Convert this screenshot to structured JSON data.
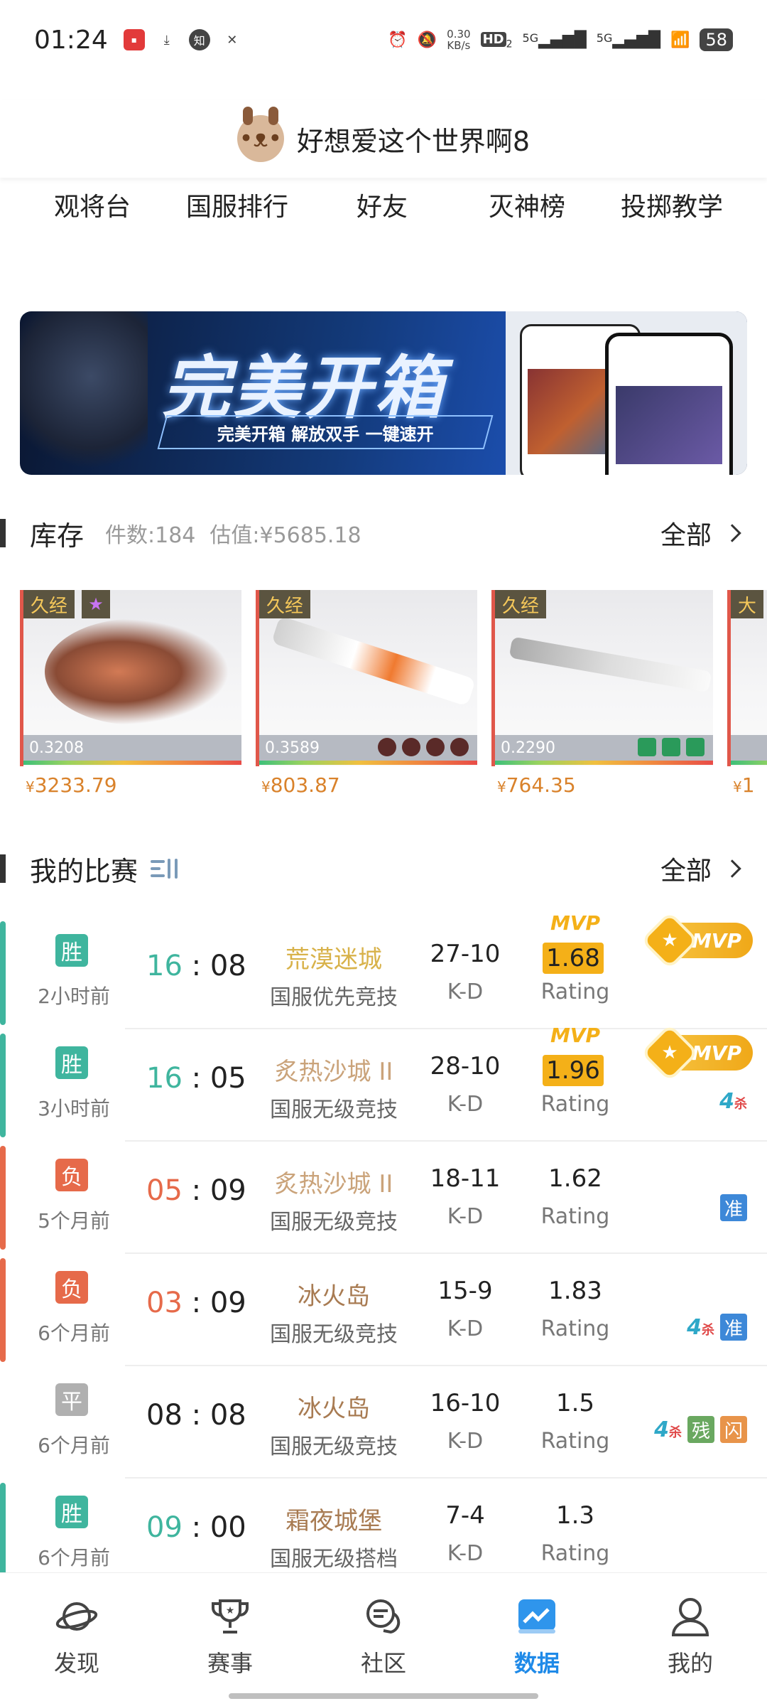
{
  "status_bar": {
    "time": "01:24",
    "net_speed_value": "0.30",
    "net_speed_unit": "KB/s",
    "hd_label": "HD",
    "hd_sub": "2",
    "sim1": "5G",
    "sim2": "5G",
    "battery": "58",
    "left_icons": [
      "app-icon",
      "download-icon",
      "zhihu-icon",
      "tools-icon"
    ],
    "zhihu_glyph": "知"
  },
  "header": {
    "title": "好想爱这个世界啊8"
  },
  "quick_nav": [
    {
      "label": "观将台"
    },
    {
      "label": "国服排行"
    },
    {
      "label": "好友"
    },
    {
      "label": "灭神榜"
    },
    {
      "label": "投掷教学"
    }
  ],
  "banner": {
    "headline": "完美开箱",
    "subline": "完美开箱 解放双手 一键速开"
  },
  "inventory": {
    "title": "库存",
    "count": "件数:184",
    "value": "估值:¥5685.18",
    "all_label": "全部",
    "items": [
      {
        "tag": "久经",
        "float": "0.3208",
        "currency": "¥",
        "price": "3233.79"
      },
      {
        "tag": "久经",
        "float": "0.3589",
        "currency": "¥",
        "price": "803.87"
      },
      {
        "tag": "久经",
        "float": "0.2290",
        "currency": "¥",
        "price": "764.35"
      },
      {
        "tag": "大",
        "currency": "¥",
        "price": "1"
      }
    ]
  },
  "matches": {
    "title": "我的比赛",
    "all_label": "全部",
    "kd_label": "K-D",
    "rating_label": "Rating",
    "mvp_label": "MVP",
    "colors": {
      "win": "#3fb59e",
      "lose": "#e66a4a",
      "draw": "#b0b0b0"
    },
    "rows": [
      {
        "result": "胜",
        "when": "2小时前",
        "s1": "16",
        "s2": "08",
        "map": "荒漠迷城",
        "mode": "国服优先竞技",
        "kd": "27-10",
        "rating": "1.68"
      },
      {
        "result": "胜",
        "when": "3小时前",
        "s1": "16",
        "s2": "05",
        "map": "炙热沙城 II",
        "mode": "国服无级竞技",
        "kd": "28-10",
        "rating": "1.96",
        "tag4": "4",
        "tag4sub": "杀"
      },
      {
        "result": "负",
        "when": "5个月前",
        "s1": "05",
        "s2": "09",
        "map": "炙热沙城 II",
        "mode": "国服无级竞技",
        "kd": "18-11",
        "rating": "1.62",
        "tagz": "准"
      },
      {
        "result": "负",
        "when": "6个月前",
        "s1": "03",
        "s2": "09",
        "map": "冰火岛",
        "mode": "国服无级竞技",
        "kd": "15-9",
        "rating": "1.83",
        "tag4": "4",
        "tag4sub": "杀",
        "tagz": "准"
      },
      {
        "result": "平",
        "when": "6个月前",
        "s1": "08",
        "s2": "08",
        "map": "冰火岛",
        "mode": "国服无级竞技",
        "kd": "16-10",
        "rating": "1.5",
        "tag4": "4",
        "tag4sub": "杀",
        "tagc": "残",
        "tags": "闪"
      },
      {
        "result": "胜",
        "when": "6个月前",
        "s1": "09",
        "s2": "00",
        "map": "霜夜城堡",
        "mode": "国服无级搭档",
        "kd": "7-4",
        "rating": "1.3"
      }
    ]
  },
  "bottom_nav": [
    {
      "label": "发现",
      "icon": "planet-icon"
    },
    {
      "label": "赛事",
      "icon": "trophy-icon"
    },
    {
      "label": "社区",
      "icon": "chat-icon"
    },
    {
      "label": "数据",
      "icon": "chart-icon",
      "active": true
    },
    {
      "label": "我的",
      "icon": "person-icon"
    }
  ]
}
